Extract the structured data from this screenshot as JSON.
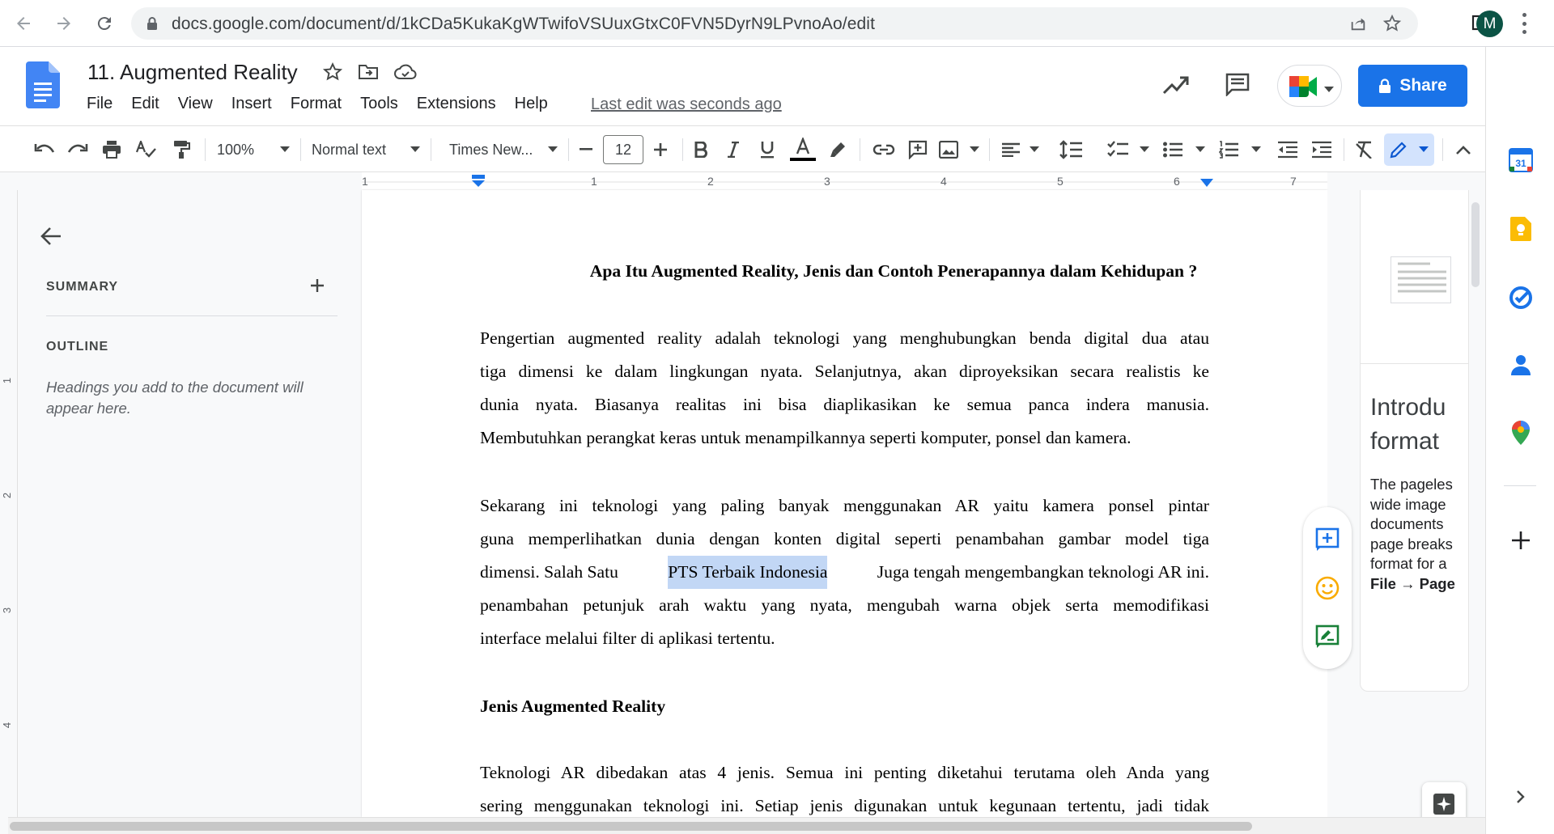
{
  "browser": {
    "url": "docs.google.com/document/d/1kCDa5KukaKgWTwifoVSUuxGtxC0FVN5DyrN9LPvnoAo/edit",
    "profile_initial": "M"
  },
  "docs": {
    "title": "11. Augmented Reality",
    "menu": [
      "File",
      "Edit",
      "View",
      "Insert",
      "Format",
      "Tools",
      "Extensions",
      "Help"
    ],
    "last_edit": "Last edit was seconds ago",
    "share_label": "Share",
    "account_initial": "M"
  },
  "toolbar": {
    "zoom": "100%",
    "style": "Normal text",
    "font": "Times New...",
    "font_size": "12",
    "text_color": "#000000"
  },
  "ruler": {
    "numbers": [
      "1",
      "1",
      "2",
      "3",
      "4",
      "5",
      "6",
      "7"
    ]
  },
  "vruler": {
    "numbers": [
      "1",
      "2",
      "3",
      "4"
    ]
  },
  "outline": {
    "summary_label": "SUMMARY",
    "outline_label": "OUTLINE",
    "placeholder_line1": "Headings you add to the document will",
    "placeholder_line2": "appear here."
  },
  "document": {
    "heading": "Apa Itu Augmented Reality, Jenis dan Contoh Penerapannya dalam Kehidupan ?",
    "p1": [
      "Pengertian augmented reality adalah teknologi yang menghubungkan benda digital dua atau",
      "tiga dimensi ke dalam lingkungan nyata. Selanjutnya, akan diproyeksikan secara realistis ke",
      "dunia nyata. Biasanya realitas ini bisa diaplikasikan ke semua panca indera manusia.",
      "Membutuhkan perangkat keras untuk menampilkannya seperti komputer, ponsel dan kamera."
    ],
    "p2_line1": "Sekarang ini teknologi yang paling banyak menggunakan AR yaitu kamera ponsel pintar",
    "p2_line2": "guna memperlihatkan dunia dengan konten digital seperti penambahan gambar model tiga",
    "p2_line3_before": "dimensi. Salah Satu",
    "p2_line3_highlight": "PTS Terbaik Indonesia",
    "p2_line3_after": "Juga tengah mengembangkan teknologi AR ini.",
    "p2_line4": "penambahan petunjuk arah waktu yang nyata, mengubah warna objek serta memodifikasi",
    "p2_line5": "interface melalui filter di aplikasi tertentu.",
    "heading2": "Jenis Augmented Reality",
    "p3_line1": "Teknologi AR dibedakan atas 4 jenis. Semua ini penting diketahui terutama oleh Anda yang",
    "p3_line2": "sering menggunakan teknologi ini. Setiap jenis digunakan untuk kegunaan tertentu, jadi tidak"
  },
  "template_card": {
    "title_line1": "Introdu",
    "title_line2": "format",
    "body_lines": [
      "The pageles",
      "wide image",
      "documents",
      "page breaks",
      "format for a"
    ],
    "path": "File → Page"
  },
  "colors": {
    "accent": "#1a73e8",
    "highlight": "#c2d7f5",
    "avatar": "#0b5345",
    "docs_blue": "#4285f4"
  }
}
